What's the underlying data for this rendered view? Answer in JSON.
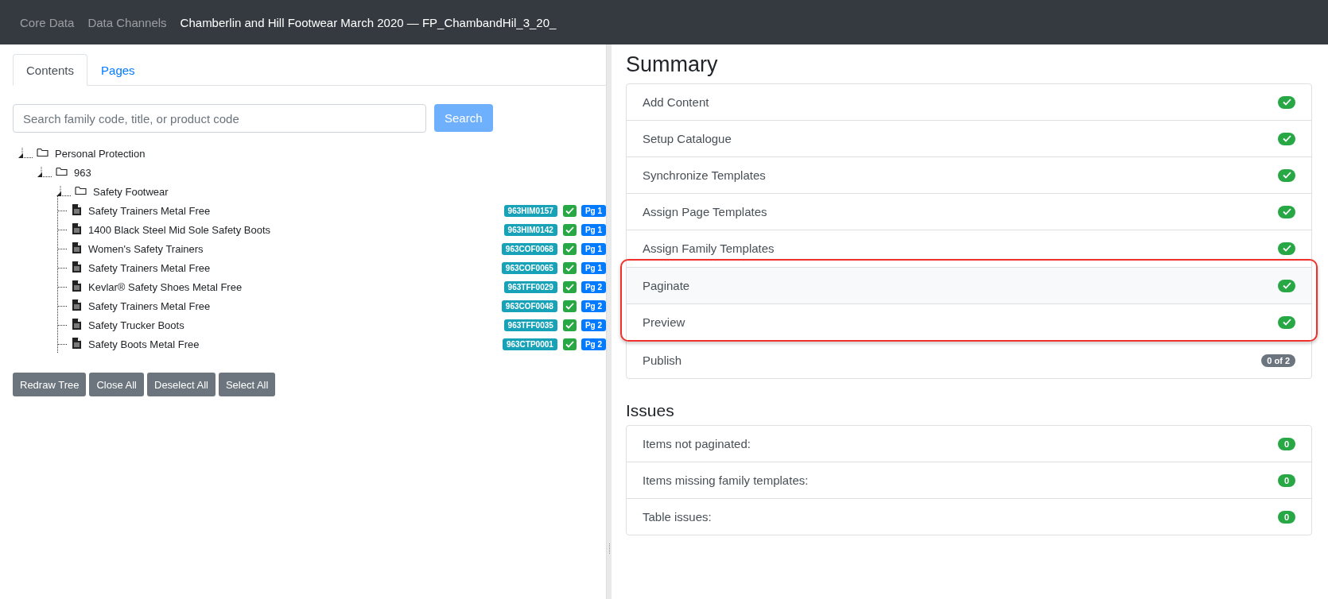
{
  "navbar": {
    "links": [
      "Core Data",
      "Data Channels"
    ],
    "title": "Chamberlin and Hill Footwear March 2020 — FP_ChambandHil_3_20_"
  },
  "tabs": [
    {
      "label": "Contents",
      "selected": true
    },
    {
      "label": "Pages",
      "selected": false
    }
  ],
  "search": {
    "placeholder": "Search family code, title, or product code",
    "button": "Search"
  },
  "tree": [
    {
      "kind": "folder",
      "label": "Personal Protection",
      "expanded": true,
      "children": [
        {
          "kind": "folder",
          "label": "963",
          "expanded": true,
          "children": [
            {
              "kind": "folder",
              "label": "Safety Footwear",
              "expanded": true,
              "children": [
                {
                  "kind": "item",
                  "label": "Safety Trainers Metal Free",
                  "code": "963HIM0157",
                  "checked": true,
                  "page": "Pg 1"
                },
                {
                  "kind": "item",
                  "label": "1400 Black Steel Mid Sole Safety Boots",
                  "code": "963HIM0142",
                  "checked": true,
                  "page": "Pg 1"
                },
                {
                  "kind": "item",
                  "label": "Women's Safety Trainers",
                  "code": "963COF0068",
                  "checked": true,
                  "page": "Pg 1"
                },
                {
                  "kind": "item",
                  "label": "Safety Trainers Metal Free",
                  "code": "963COF0065",
                  "checked": true,
                  "page": "Pg 1"
                },
                {
                  "kind": "item",
                  "label": "Kevlar® Safety Shoes Metal Free",
                  "code": "963TFF0029",
                  "checked": true,
                  "page": "Pg 2"
                },
                {
                  "kind": "item",
                  "label": "Safety Trainers Metal Free",
                  "code": "963COF0048",
                  "checked": true,
                  "page": "Pg 2"
                },
                {
                  "kind": "item",
                  "label": "Safety Trucker Boots",
                  "code": "963TFF0035",
                  "checked": true,
                  "page": "Pg 2"
                },
                {
                  "kind": "item",
                  "label": "Safety Boots Metal Free",
                  "code": "963CTP0001",
                  "checked": true,
                  "page": "Pg 2"
                }
              ]
            }
          ]
        }
      ]
    }
  ],
  "tree_buttons": [
    "Redraw Tree",
    "Close All",
    "Deselect All",
    "Select All"
  ],
  "summary": {
    "title": "Summary",
    "steps": [
      {
        "label": "Add Content",
        "kind": "done",
        "highlighted": false
      },
      {
        "label": "Setup Catalogue",
        "kind": "done",
        "highlighted": false
      },
      {
        "label": "Synchronize Templates",
        "kind": "done",
        "highlighted": false
      },
      {
        "label": "Assign Page Templates",
        "kind": "done",
        "highlighted": false
      },
      {
        "label": "Assign Family Templates",
        "kind": "done",
        "highlighted": false
      },
      {
        "label": "Paginate",
        "kind": "done",
        "highlighted": true
      },
      {
        "label": "Preview",
        "kind": "done",
        "highlighted": true
      },
      {
        "label": "Publish",
        "kind": "count",
        "count": "0 of 2",
        "highlighted": false
      }
    ]
  },
  "issues": {
    "title": "Issues",
    "items": [
      {
        "label": "Items not paginated:",
        "count": "0"
      },
      {
        "label": "Items missing family templates:",
        "count": "0"
      },
      {
        "label": "Table issues:",
        "count": "0"
      }
    ]
  }
}
